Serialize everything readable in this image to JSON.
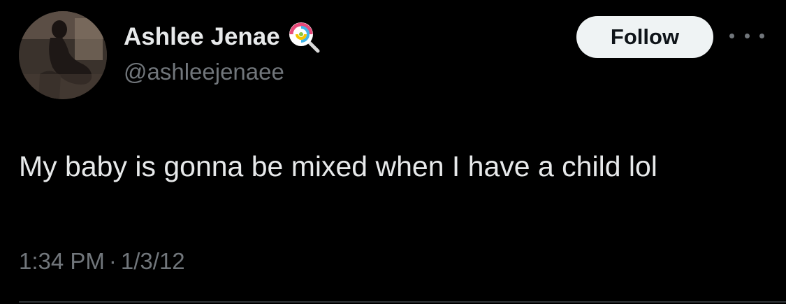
{
  "user": {
    "display_name": "Ashlee Jenae",
    "handle": "@ashleejenaee",
    "badge_icon": "lollipop-icon"
  },
  "actions": {
    "follow_label": "Follow",
    "more_icon": "more-dots-icon"
  },
  "tweet": {
    "text": "My baby is gonna be mixed when I have a child lol",
    "time": "1:34 PM",
    "separator": "·",
    "date": "1/3/12"
  },
  "colors": {
    "background": "#000000",
    "primary_text": "#e7e9ea",
    "secondary_text": "#71767b",
    "button_bg": "#eff3f4",
    "button_text": "#0f1419",
    "divider": "#2f3336"
  }
}
